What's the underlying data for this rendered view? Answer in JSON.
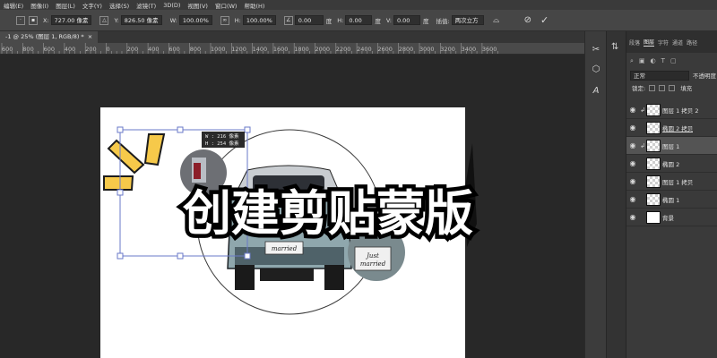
{
  "menubar": {
    "items": [
      "编辑(E)",
      "图像(I)",
      "图层(L)",
      "文字(Y)",
      "选择(S)",
      "滤镜(T)",
      "3D(D)",
      "视图(V)",
      "窗口(W)",
      "帮助(H)"
    ]
  },
  "options": {
    "x_label": "X:",
    "x_value": "727.00 像素",
    "y_label": "Y:",
    "y_value": "826.50 像素",
    "w_label": "W:",
    "w_value": "100.00%",
    "h_label": "H:",
    "h_value": "100.00%",
    "angle_value": "0.00",
    "hskew_label": "H:",
    "hskew_value": "0.00",
    "vskew_label": "V:",
    "vskew_value": "0.00",
    "deg_label": "度",
    "interp_label": "插值:",
    "interp_value": "两次立方"
  },
  "document": {
    "tab_title": "-1 @ 25% (图层 1, RGB/8) *",
    "close_glyph": "×"
  },
  "ruler": {
    "labels": [
      "600",
      "800",
      "600",
      "400",
      "200",
      "0",
      "200",
      "400",
      "600",
      "800",
      "1000",
      "1200",
      "1400",
      "1600",
      "1800",
      "2000",
      "2200",
      "2400",
      "2600",
      "2800",
      "3000",
      "3200",
      "3400",
      "3600"
    ]
  },
  "canvas_content": {
    "title": "创建剪贴蒙版",
    "readout_w": "W : 216 像素",
    "readout_h": "H : 254 像素",
    "plate_text": "married",
    "sign_line1": "Just",
    "sign_line2": "married"
  },
  "layers": {
    "tabs": [
      "段落",
      "图层",
      "字符",
      "通道",
      "路径"
    ],
    "active_tab": "图层",
    "blend_mode": "正常",
    "opacity_label": "不透明度",
    "lock_label": "锁定:",
    "fill_label": "填充",
    "rows": [
      {
        "name": "图层 1 拷贝 2",
        "selected": false,
        "clipped": true,
        "thumb": "checker"
      },
      {
        "name": "椭圆 2 拷贝",
        "selected": false,
        "clipped": false,
        "thumb": "checker"
      },
      {
        "name": "图层 1",
        "selected": true,
        "clipped": true,
        "thumb": "checker"
      },
      {
        "name": "椭圆 2",
        "selected": false,
        "clipped": false,
        "thumb": "checker"
      },
      {
        "name": "图层 1 拷贝",
        "selected": false,
        "clipped": false,
        "thumb": "checker"
      },
      {
        "name": "椭圆 1",
        "selected": false,
        "clipped": false,
        "thumb": "checker"
      },
      {
        "name": "背景",
        "selected": false,
        "clipped": false,
        "thumb": "white"
      }
    ]
  },
  "colors": {
    "accent_yellow": "#f6c94a",
    "ui_dark": "#282828",
    "panel_bg": "#3a3a3a",
    "selection_line": "#6a79c8"
  },
  "icons": {
    "cancel": "cancel-icon",
    "commit": "commit-check-icon",
    "warp": "warp-icon",
    "scissors": "scissors-icon",
    "cube": "3d-cube-icon",
    "type_tool": "type-icon"
  }
}
